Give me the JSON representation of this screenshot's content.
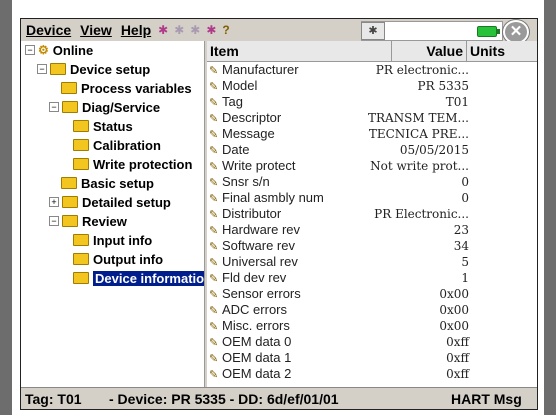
{
  "menubar": {
    "items": [
      "Device",
      "View",
      "Help"
    ],
    "toolbar_icons": [
      "hart-device-icon",
      "hart-device-icon-disabled",
      "hart-device-icon-disabled",
      "hart-device-settings-icon",
      "help-icon"
    ]
  },
  "window_controls": {
    "battery": "battery-icon",
    "close": "✕"
  },
  "tree": {
    "items": [
      {
        "label": "Online",
        "level": 0,
        "expander": "−",
        "icon": "online-icon"
      },
      {
        "label": "Device setup",
        "level": 1,
        "expander": "−",
        "icon": "folder-icon"
      },
      {
        "label": "Process variables",
        "level": 2,
        "expander": "",
        "icon": "folder-icon"
      },
      {
        "label": "Diag/Service",
        "level": 2,
        "expander": "−",
        "icon": "folder-icon"
      },
      {
        "label": "Status",
        "level": 3,
        "expander": "",
        "icon": "folder-icon"
      },
      {
        "label": "Calibration",
        "level": 3,
        "expander": "",
        "icon": "folder-icon"
      },
      {
        "label": "Write protection",
        "level": 3,
        "expander": "",
        "icon": "folder-icon"
      },
      {
        "label": "Basic setup",
        "level": 2,
        "expander": "",
        "icon": "folder-icon"
      },
      {
        "label": "Detailed setup",
        "level": 2,
        "expander": "+",
        "icon": "folder-icon"
      },
      {
        "label": "Review",
        "level": 2,
        "expander": "−",
        "icon": "folder-icon"
      },
      {
        "label": "Input info",
        "level": 3,
        "expander": "",
        "icon": "folder-icon"
      },
      {
        "label": "Output info",
        "level": 3,
        "expander": "",
        "icon": "folder-icon"
      },
      {
        "label": "Device information",
        "level": 3,
        "expander": "",
        "icon": "folder-icon",
        "selected": true
      }
    ]
  },
  "list": {
    "headers": {
      "item": "Item",
      "value": "Value",
      "units": "Units"
    },
    "rows": [
      {
        "item": "Manufacturer",
        "value": "PR electronic..."
      },
      {
        "item": "Model",
        "value": "PR 5335"
      },
      {
        "item": "Tag",
        "value": "T01"
      },
      {
        "item": "Descriptor",
        "value": "TRANSM TEM..."
      },
      {
        "item": "Message",
        "value": "TECNICA PRE..."
      },
      {
        "item": "Date",
        "value": "05/05/2015"
      },
      {
        "item": "Write protect",
        "value": "Not write prot..."
      },
      {
        "item": "Snsr s/n",
        "value": "0"
      },
      {
        "item": "Final asmbly num",
        "value": "0"
      },
      {
        "item": "Distributor",
        "value": "PR Electronic..."
      },
      {
        "item": "Hardware rev",
        "value": "23"
      },
      {
        "item": "Software rev",
        "value": "34"
      },
      {
        "item": "Universal rev",
        "value": "5"
      },
      {
        "item": "Fld dev rev",
        "value": "1"
      },
      {
        "item": "Sensor errors",
        "value": "0x00"
      },
      {
        "item": "ADC errors",
        "value": "0x00"
      },
      {
        "item": "Misc. errors",
        "value": "0x00"
      },
      {
        "item": "OEM data 0",
        "value": "0xff"
      },
      {
        "item": "OEM data 1",
        "value": "0xff"
      },
      {
        "item": "OEM data 2",
        "value": "0xff"
      }
    ]
  },
  "statusbar": {
    "tag": "Tag: T01",
    "device": "- Device: PR 5335 - DD: 6d/ef/01/01",
    "protocol": "HART Msg"
  }
}
